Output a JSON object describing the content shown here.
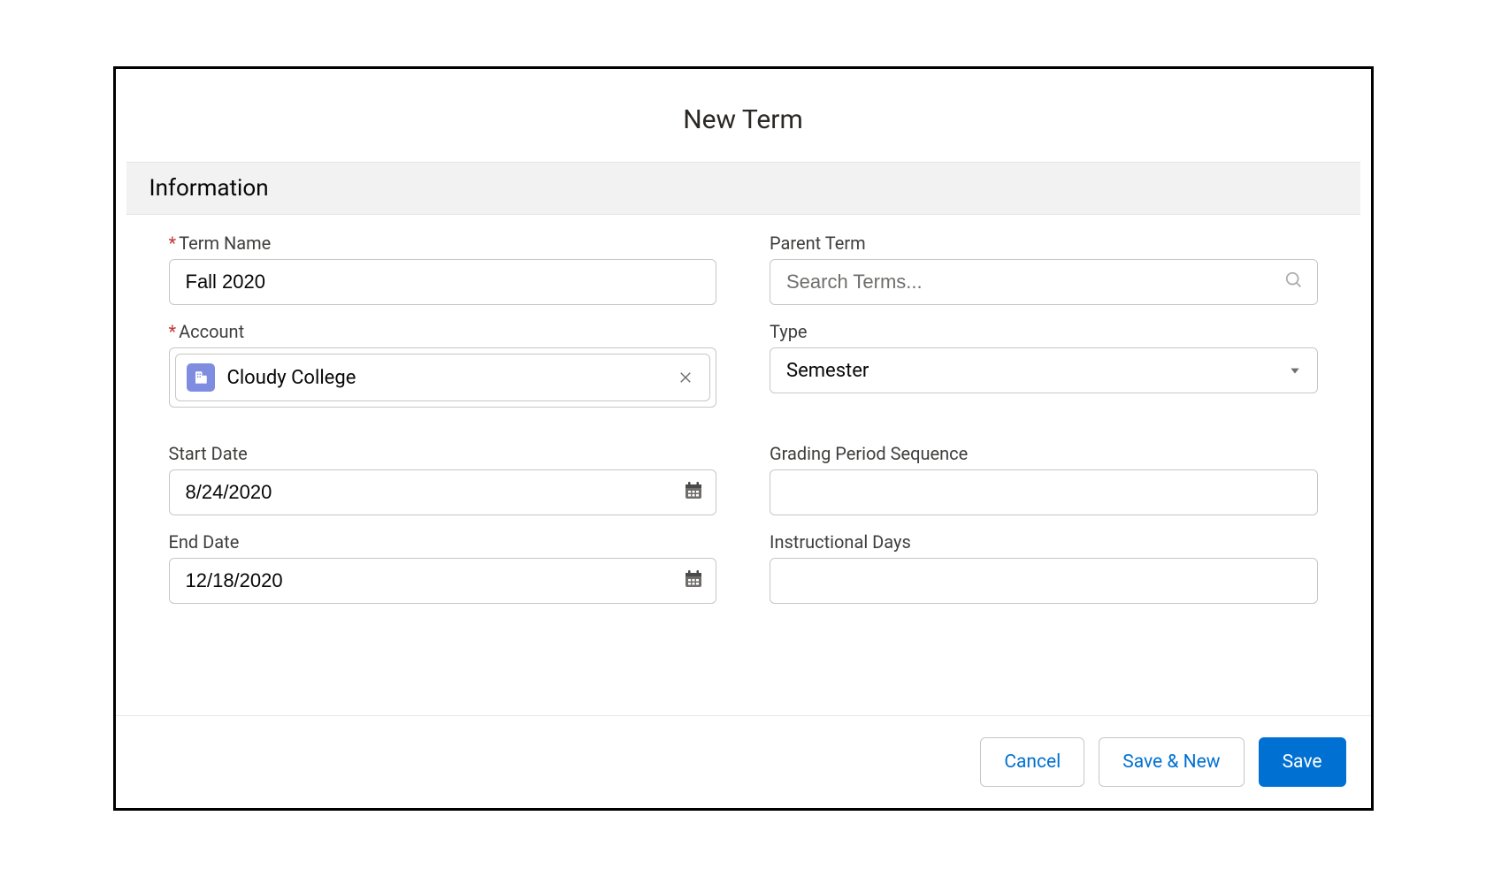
{
  "modal": {
    "title": "New Term"
  },
  "section": {
    "information": "Information"
  },
  "labels": {
    "term_name": "Term Name",
    "parent_term": "Parent Term",
    "account": "Account",
    "type": "Type",
    "start_date": "Start Date",
    "grading_period_sequence": "Grading Period Sequence",
    "end_date": "End Date",
    "instructional_days": "Instructional Days"
  },
  "values": {
    "term_name": "Fall 2020",
    "parent_term": "",
    "parent_term_placeholder": "Search Terms...",
    "account": "Cloudy College",
    "type": "Semester",
    "start_date": "8/24/2020",
    "end_date": "12/18/2020",
    "grading_period_sequence": "",
    "instructional_days": ""
  },
  "footer": {
    "cancel": "Cancel",
    "save_new": "Save & New",
    "save": "Save"
  }
}
